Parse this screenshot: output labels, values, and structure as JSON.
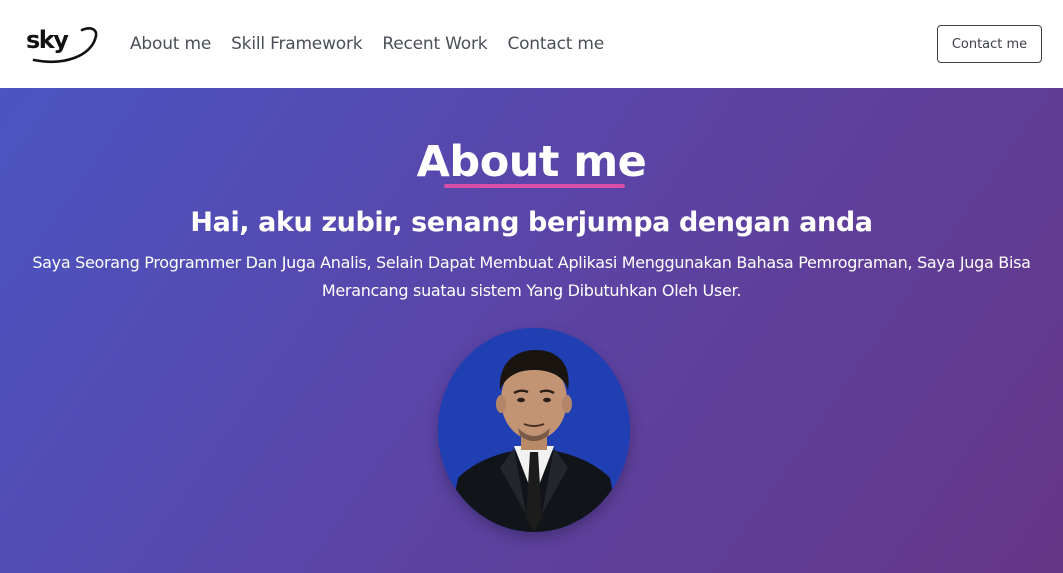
{
  "brand": {
    "logo_text": "sky"
  },
  "nav": {
    "links": [
      "About me",
      "Skill Framework",
      "Recent Work",
      "Contact me"
    ],
    "contact_button": "Contact me"
  },
  "hero": {
    "title": "About me",
    "subtitle": "Hai, aku zubir, senang berjumpa dengan anda",
    "description": "Saya Seorang Programmer Dan Juga Analis, Selain Dapat Membuat Aplikasi Menggunakan Bahasa Pemrograman, Saya Juga Bisa Merancang suatau sistem Yang Dibutuhkan Oleh User."
  },
  "colors": {
    "gradient_start": "#4a55c2",
    "gradient_end": "#663686",
    "underline_accent": "#d94ea7",
    "photo_background": "#1f3fb3"
  }
}
